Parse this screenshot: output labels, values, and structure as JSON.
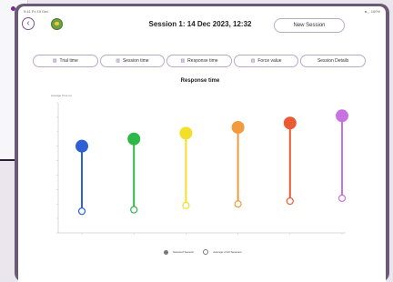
{
  "status_bar": {
    "time": "9:41 Fri 15 Dec",
    "battery": "●◡ 100%"
  },
  "header": {
    "back_icon": "chevron-left-icon",
    "title": "Session 1: 14 Dec 2023, 12:32",
    "new_session_label": "New Session"
  },
  "tabs": [
    {
      "label": "Trial time",
      "icon": "chart-icon"
    },
    {
      "label": "Session time",
      "icon": "chart-icon"
    },
    {
      "label": "Response time",
      "icon": "chart-icon"
    },
    {
      "label": "Force value",
      "icon": "chart-icon"
    },
    {
      "label": "Session Details",
      "icon": ""
    }
  ],
  "chart_data": {
    "type": "line",
    "title": "Response time",
    "ylabel": "Average Time (s)",
    "series": [
      {
        "name": "Selected Session",
        "values": [
          6.0,
          6.5,
          6.9,
          7.3,
          7.6,
          8.1
        ],
        "colors": [
          "#2f5fd4",
          "#2fb84a",
          "#f2df27",
          "#f19a3e",
          "#ea5b35",
          "#c873e0"
        ]
      },
      {
        "name": "Average of All Sessions",
        "values": [
          1.5,
          1.6,
          1.9,
          2.0,
          2.2,
          2.4
        ]
      }
    ],
    "ylim": [
      0,
      9
    ],
    "grid": false,
    "legend": "bottom-center"
  }
}
